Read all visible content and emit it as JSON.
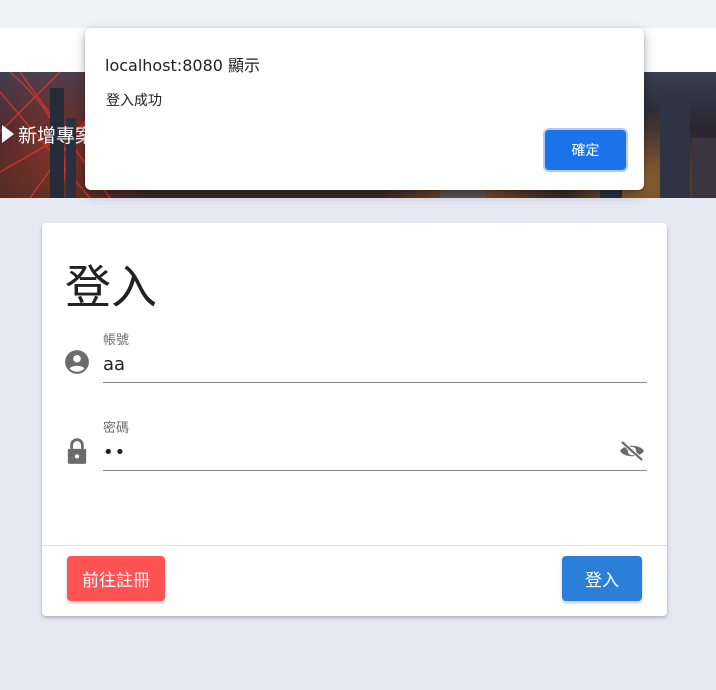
{
  "header": {
    "nav_add_project": "新增專案"
  },
  "login": {
    "title": "登入",
    "account_label": "帳號",
    "account_value": "aa",
    "password_label": "密碼",
    "password_value": "aa",
    "register_button": "前往註冊",
    "login_button": "登入"
  },
  "alert": {
    "title": "localhost:8080 顯示",
    "message": "登入成功",
    "ok_button": "確定"
  },
  "icons": {
    "account": "account-circle-icon",
    "password": "lock-icon",
    "toggle": "eye-off-icon",
    "nav": "pencil-icon"
  },
  "colors": {
    "background": "#e6e8f4",
    "register_button": "#ff5252",
    "login_button": "#2b7fd9",
    "dialog_ok": "#1a73e8"
  }
}
